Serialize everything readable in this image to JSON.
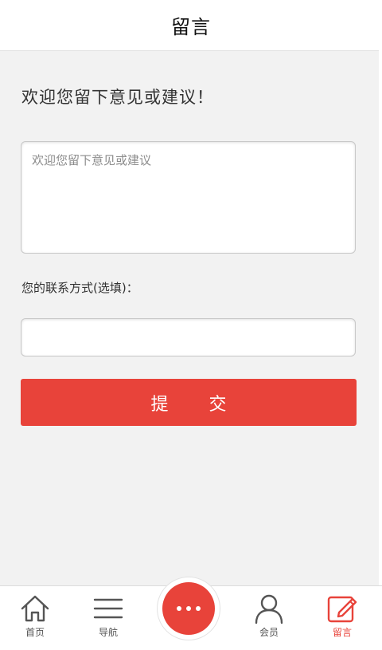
{
  "header": {
    "title": "留言"
  },
  "form": {
    "welcome_text": "欢迎您留下意见或建议！",
    "message_placeholder": "欢迎您留下意见或建议",
    "message_value": "",
    "contact_label": "您的联系方式(选填)：",
    "contact_placeholder": "",
    "contact_value": "",
    "submit_label": "提 交"
  },
  "tabbar": {
    "items": [
      {
        "label": "首页",
        "icon": "home-icon",
        "active": false
      },
      {
        "label": "导航",
        "icon": "menu-icon",
        "active": false
      },
      {
        "label": "",
        "icon": "more-dots-icon",
        "active": false
      },
      {
        "label": "会员",
        "icon": "user-icon",
        "active": false
      },
      {
        "label": "留言",
        "icon": "edit-icon",
        "active": true
      }
    ]
  },
  "colors": {
    "accent": "#e8433a",
    "background": "#f2f2f2",
    "text": "#333333",
    "icon": "#555555"
  }
}
